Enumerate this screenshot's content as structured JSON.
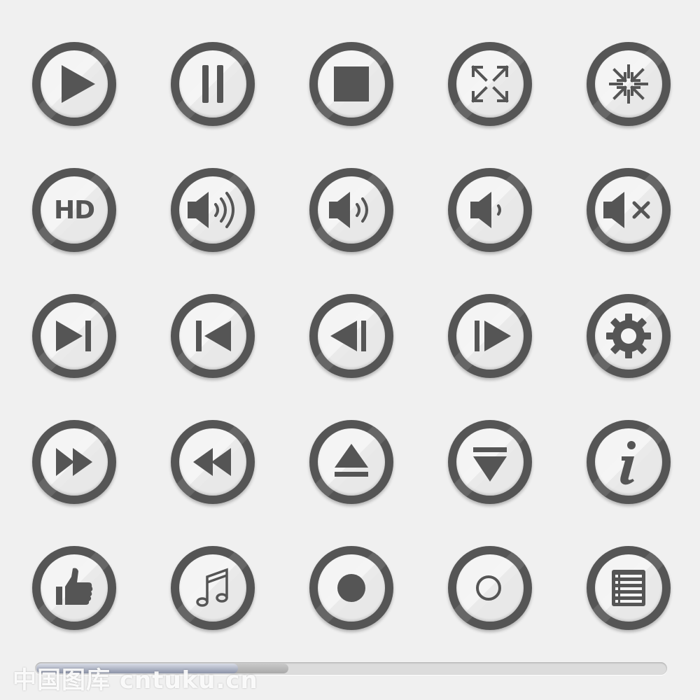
{
  "icon_color": "#555555",
  "ring_color": "#555555",
  "face_color": "#f4f4f4",
  "background": "#f0f0f0",
  "buttons": [
    [
      "play-icon",
      "pause-icon",
      "stop-icon",
      "expand-icon",
      "collapse-icon"
    ],
    [
      "hd-icon",
      "volume-high-icon",
      "volume-medium-icon",
      "volume-low-icon",
      "volume-mute-icon"
    ],
    [
      "skip-next-icon",
      "skip-previous-icon",
      "step-back-icon",
      "step-forward-icon",
      "gear-icon"
    ],
    [
      "fast-forward-icon",
      "rewind-icon",
      "eject-icon",
      "download-arrow-icon",
      "info-icon"
    ],
    [
      "thumbs-up-icon",
      "music-note-icon",
      "record-icon",
      "circle-outline-icon",
      "list-icon"
    ]
  ],
  "hd_label": "HD",
  "progress": {
    "played_fraction": 0.32,
    "buffered_fraction": 0.4
  },
  "watermark": "中国图库 cntuku.cn"
}
